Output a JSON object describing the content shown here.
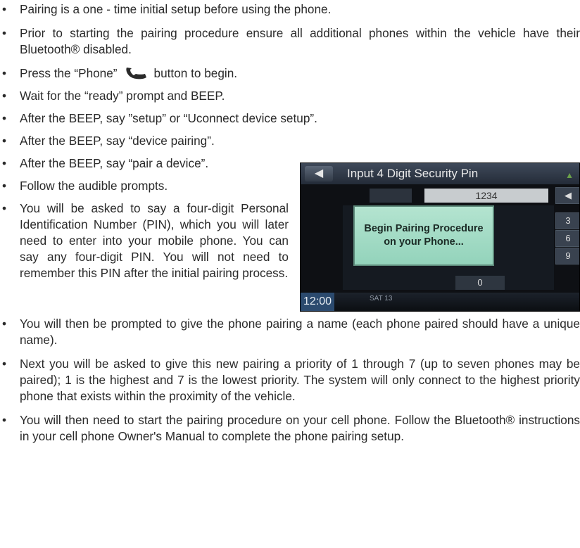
{
  "bullets": [
    "Pairing is a one - time initial setup before using the phone.",
    "Prior to starting the pairing procedure ensure all additional phones within the vehicle have their Bluetooth® disabled.",
    {
      "before": "Press the “Phone”",
      "after": "button to begin."
    },
    "Wait for the “ready” prompt and BEEP.",
    "After the BEEP, say ”setup” or “Uconnect device setup”.",
    "After the BEEP, say “device pairing”.",
    "After the BEEP, say “pair a device”.",
    "Follow the audible prompts.",
    "You will be asked to say a four-digit Personal Identification Number (PIN), which you will later need to enter into your mobile phone. You can say any four-digit PIN. You will not need to remember this PIN after the initial pairing process.",
    "You will then be prompted to give the phone pairing a name (each phone paired should have a unique name).",
    "Next you will be asked to give this new pairing a priority of 1 through 7 (up to seven phones may be paired); 1 is the highest and 7 is the lowest priority. The system will only connect to the highest priority phone that exists within the proximity of the vehicle.",
    "You will then need to start the pairing procedure on your cell phone. Follow the Bluetooth® instructions in your cell phone Owner's Manual to complete the phone pairing setup."
  ],
  "screen": {
    "title": "Input 4 Digit Security Pin",
    "pin_value": "1234",
    "dialog_line1": "Begin Pairing Procedure",
    "dialog_line2": "on your Phone...",
    "keys": [
      "3",
      "6",
      "9",
      "0"
    ],
    "clock": "12:00",
    "date": "SAT 13",
    "icons": [
      "back-arrow-icon",
      "signal-icon",
      "phone-icon"
    ]
  }
}
